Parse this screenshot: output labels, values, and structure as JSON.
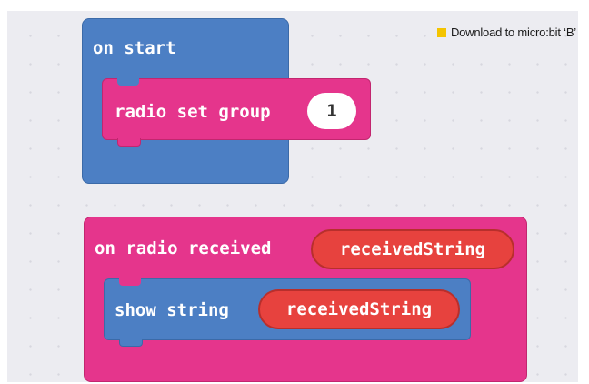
{
  "caption": {
    "text": "Download to micro:bit ‘B’",
    "marker_color": "#f4c400"
  },
  "editor": {
    "background_color": "#ececf1",
    "blocks": {
      "on_start": {
        "label": "on start",
        "color": "#4c7fc4",
        "children": {
          "radio_set_group": {
            "label": "radio set group",
            "value": "1",
            "color": "#e5358c"
          }
        }
      },
      "on_radio_received": {
        "label": "on radio received",
        "parameter": "receivedString",
        "color": "#e5358c",
        "children": {
          "show_string": {
            "label": "show string",
            "argument": "receivedString",
            "color": "#4c7fc4"
          }
        }
      }
    },
    "variable_color": "#e7423e"
  }
}
